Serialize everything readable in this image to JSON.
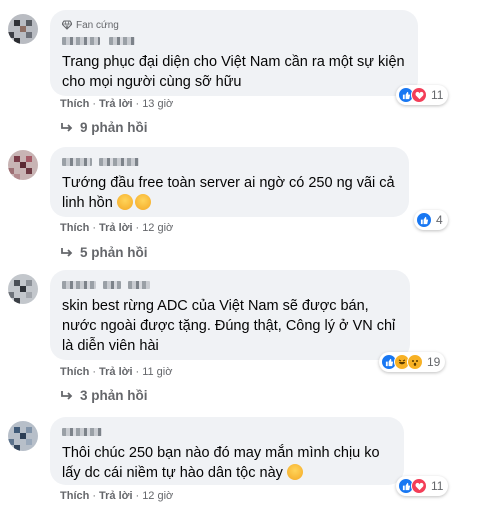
{
  "comments": [
    {
      "badge": "Fan cứng",
      "text": "Trang phục đại diện cho Việt Nam cần ra một sự kiện cho mọi người cùng sỡ hữu",
      "like_label": "Thích",
      "reply_label": "Trả lời",
      "time": "13 giờ",
      "reaction_count": "11",
      "replies_label": "9 phản hồi"
    },
    {
      "text": "Tướng đầu free toàn server ai ngờ có 250 ng vãi cả linh hồn",
      "like_label": "Thích",
      "reply_label": "Trả lời",
      "time": "12 giờ",
      "reaction_count": "4",
      "replies_label": "5 phản hồi"
    },
    {
      "text": "skin best rừng ADC của Việt Nam sẽ được bán, nước ngoài được tặng. Đúng thật, Công lý ở VN chỉ là diễn viên hài",
      "like_label": "Thích",
      "reply_label": "Trả lời",
      "time": "11 giờ",
      "reaction_count": "19",
      "replies_label": "3 phản hồi"
    },
    {
      "text": "Thôi chúc 250 bạn nào đó may mắn mình chịu ko lấy dc cái niềm tự hào dân tộc này",
      "like_label": "Thích",
      "reply_label": "Trả lời",
      "time": "12 giờ",
      "reaction_count": "11"
    }
  ],
  "colors": {
    "bubble_bg": "#f0f2f5",
    "like_blue": "#1877f2",
    "love_red": "#f33e58",
    "haha_yellow": "#f7b125",
    "meta_gray": "#65676b"
  }
}
